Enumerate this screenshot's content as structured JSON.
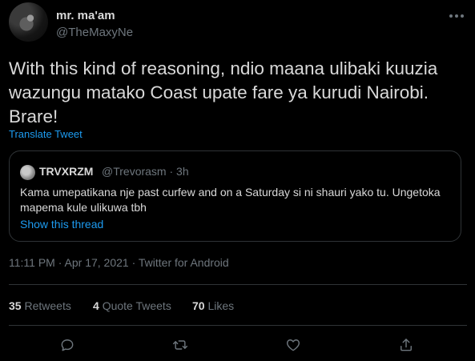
{
  "author": {
    "name": "mr. ma'am",
    "handle": "@TheMaxyNe"
  },
  "tweet": {
    "text": "With this kind of reasoning, ndio maana ulibaki kuuzia wazungu matako Coast upate fare ya kurudi Nairobi. Brare!",
    "translate_label": "Translate Tweet"
  },
  "quoted": {
    "name": "TRVXRZM",
    "handle": "@Trevorasm",
    "separator": "·",
    "time": "3h",
    "text": "Kama umepatikana nje past curfew and on a Saturday si ni shauri yako tu. Ungetoka mapema kule ulikuwa tbh",
    "show_thread": "Show this thread"
  },
  "meta": {
    "text": "11:11 PM · Apr 17, 2021 · Twitter for Android"
  },
  "stats": {
    "retweets_count": "35",
    "retweets_label": "Retweets",
    "quotes_count": "4",
    "quotes_label": "Quote Tweets",
    "likes_count": "70",
    "likes_label": "Likes"
  },
  "icons": {
    "more": "more-icon",
    "reply": "reply-icon",
    "retweet": "retweet-icon",
    "like": "like-icon",
    "share": "share-icon"
  },
  "colors": {
    "background": "#000000",
    "text": "#d9d9d9",
    "secondary": "#6e767d",
    "link": "#1d9bf0",
    "border": "#2f3336"
  }
}
